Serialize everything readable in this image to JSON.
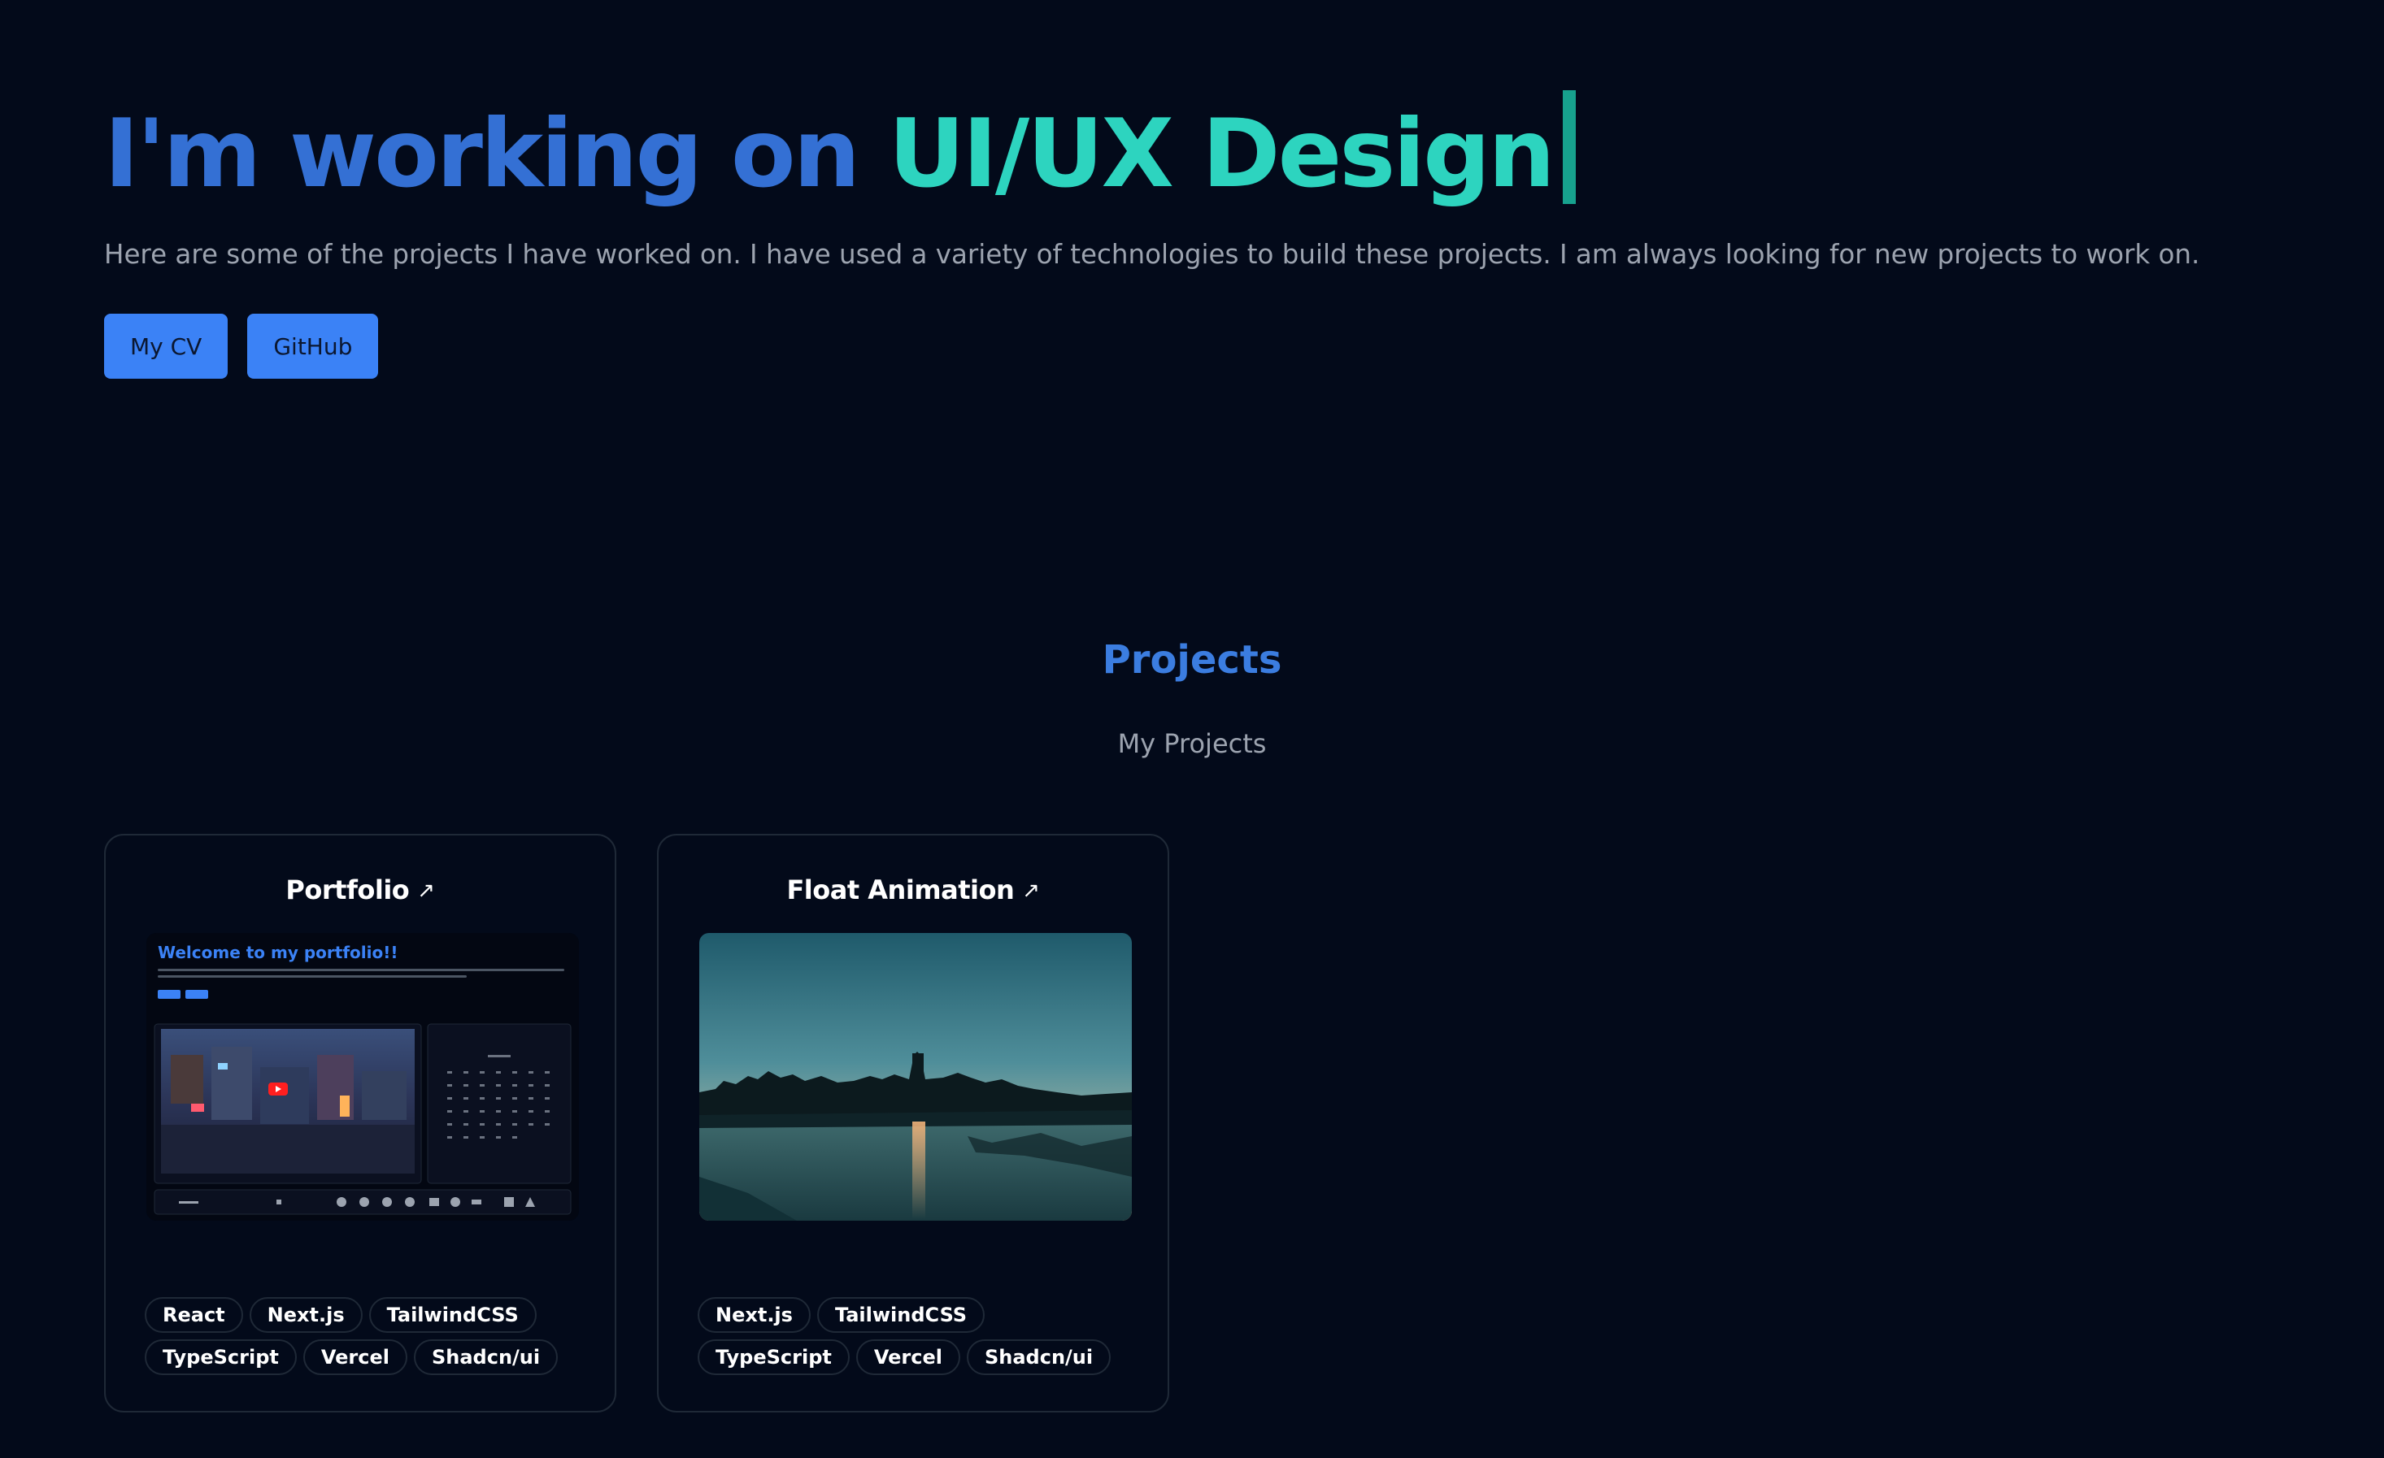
{
  "hero": {
    "prefix": "I'm working on ",
    "highlight": "UI/UX Design",
    "description": "Here are some of the projects I have worked on. I have used a variety of technologies to build these projects. I am always looking for new projects to work on.",
    "buttons": {
      "cv": "My CV",
      "github": "GitHub"
    }
  },
  "projects": {
    "title": "Projects",
    "subtitle": "My Projects",
    "cards": [
      {
        "title": "Portfolio",
        "preview_heading": "Welcome to my portfolio!!",
        "tags": [
          "React",
          "Next.js",
          "TailwindCSS",
          "TypeScript",
          "Vercel",
          "Shadcn/ui"
        ]
      },
      {
        "title": "Float Animation",
        "tags": [
          "Next.js",
          "TailwindCSS",
          "TypeScript",
          "Vercel",
          "Shadcn/ui"
        ]
      }
    ]
  },
  "icons": {
    "external_link": "arrow-up-right-icon",
    "cursor": "text-cursor"
  },
  "colors": {
    "background": "#030a1a",
    "title_blue": "#3470d4",
    "highlight_teal": "#2dd4bf",
    "button_blue": "#3b82f6",
    "muted_text": "#9ca3af",
    "card_border": "#1f2937"
  }
}
